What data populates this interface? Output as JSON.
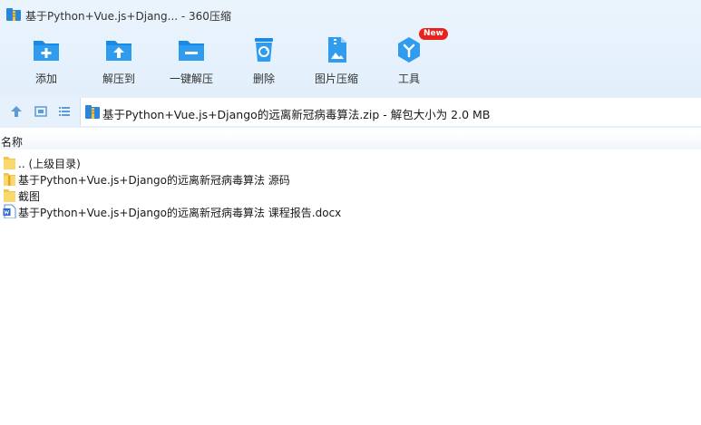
{
  "window": {
    "title": "基于Python+Vue.js+Djang... - 360压缩"
  },
  "toolbar": {
    "items": [
      {
        "label": "添加",
        "icon": "add-icon"
      },
      {
        "label": "解压到",
        "icon": "extract-to-icon"
      },
      {
        "label": "一键解压",
        "icon": "one-click-extract-icon"
      },
      {
        "label": "删除",
        "icon": "recycle-icon"
      },
      {
        "label": "图片压缩",
        "icon": "image-compress-icon"
      },
      {
        "label": "工具",
        "icon": "tools-icon",
        "badge": "New"
      }
    ]
  },
  "address": {
    "path": "基于Python+Vue.js+Django的远离新冠病毒算法.zip - 解包大小为 2.0 MB"
  },
  "list": {
    "header": "名称",
    "rows": [
      {
        "name": ".. (上级目录)",
        "icon": "folder-icon"
      },
      {
        "name": "基于Python+Vue.js+Django的远离新冠病毒算法 源码",
        "icon": "zip-folder-icon"
      },
      {
        "name": "截图",
        "icon": "folder-icon"
      },
      {
        "name": "基于Python+Vue.js+Django的远离新冠病毒算法 课程报告.docx",
        "icon": "word-doc-icon"
      }
    ]
  },
  "colors": {
    "accent": "#1f8ee8",
    "toolbar_bg": "#e6f1fb",
    "badge": "#e8231e"
  }
}
